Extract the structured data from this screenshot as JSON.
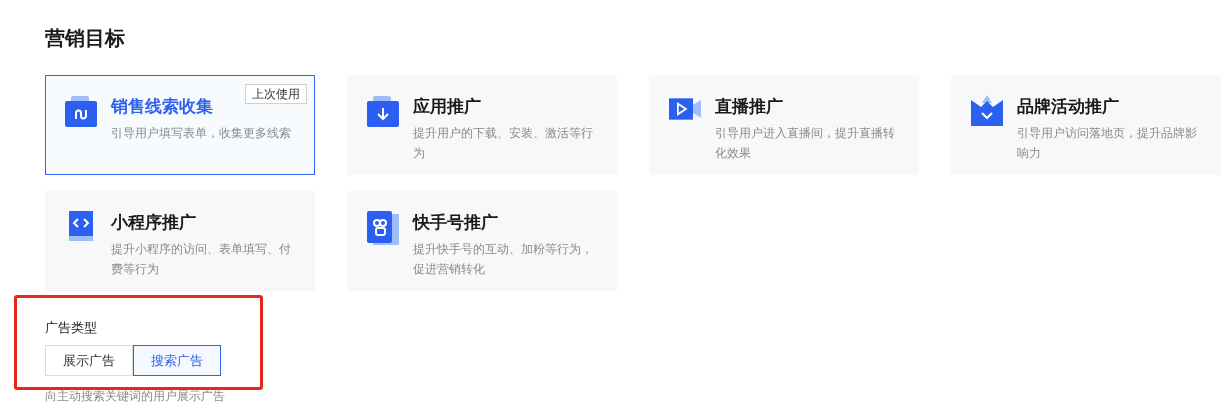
{
  "section_title": "营销目标",
  "goals": [
    {
      "title": "销售线索收集",
      "description": "引导用户填写表单，收集更多线索",
      "selected": true,
      "badge": "上次使用"
    },
    {
      "title": "应用推广",
      "description": "提升用户的下载、安装、激活等行为",
      "selected": false
    },
    {
      "title": "直播推广",
      "description": "引导用户进入直播间，提升直播转化效果",
      "selected": false
    },
    {
      "title": "品牌活动推广",
      "description": "引导用户访问落地页，提升品牌影响力",
      "selected": false
    },
    {
      "title": "小程序推广",
      "description": "提升小程序的访问、表单填写、付费等行为",
      "selected": false
    },
    {
      "title": "快手号推广",
      "description": "提升快手号的互动、加粉等行为，促进营销转化",
      "selected": false
    }
  ],
  "ad_type": {
    "label": "广告类型",
    "options": [
      {
        "label": "展示广告",
        "selected": false
      },
      {
        "label": "搜索广告",
        "selected": true
      }
    ],
    "description": "向主动搜索关键词的用户展示广告"
  }
}
